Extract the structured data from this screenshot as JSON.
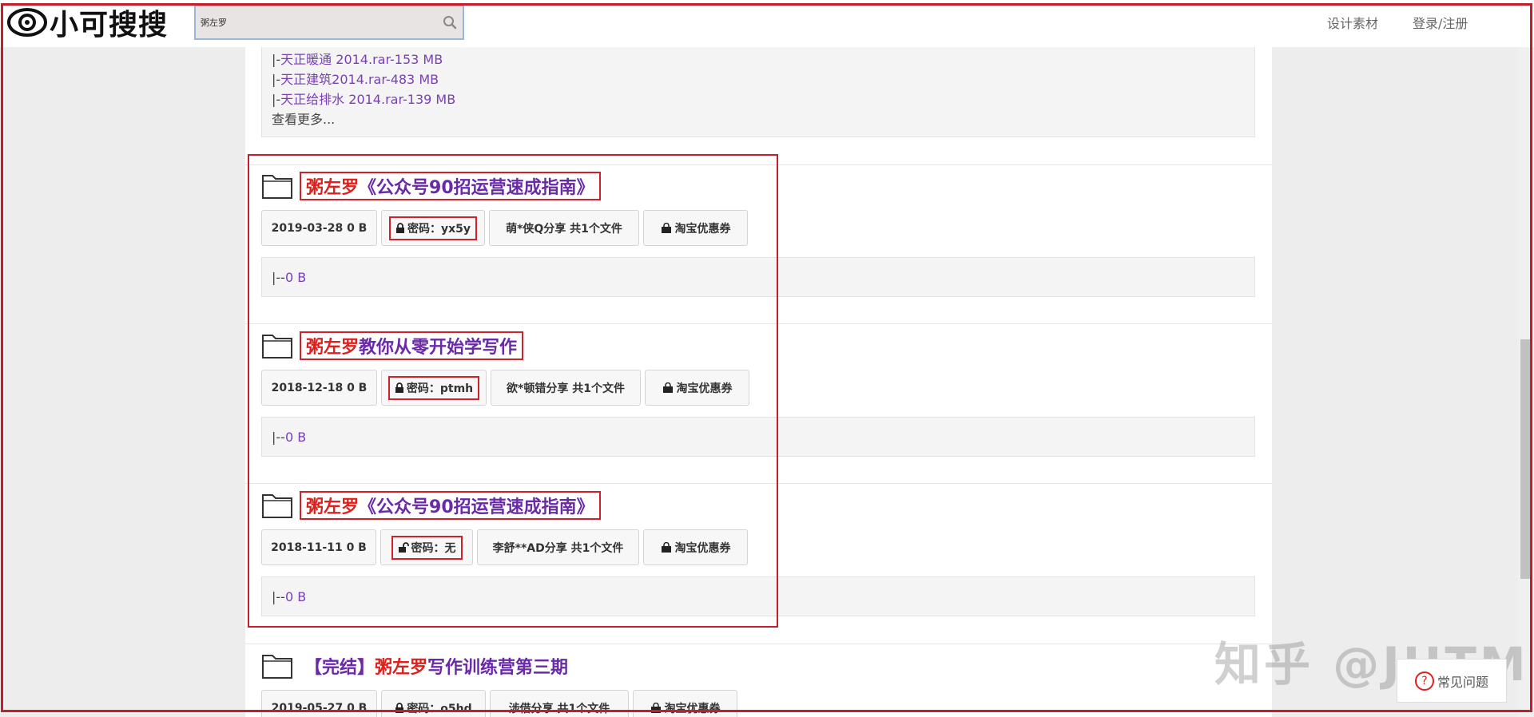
{
  "header": {
    "logo_text": "小可搜搜",
    "search_value": "粥左罗",
    "nav": {
      "design": "设计素材",
      "login": "登录/注册"
    }
  },
  "top_partial": {
    "files": [
      {
        "prefix": "|-",
        "name": "天正暖通 2014.rar-153 MB"
      },
      {
        "prefix": "|-",
        "name": "天正建筑2014.rar-483 MB"
      },
      {
        "prefix": "|-",
        "name": "天正给排水 2014.rar-139 MB"
      }
    ],
    "more": "查看更多..."
  },
  "results": [
    {
      "title_hl": "粥左罗",
      "title_rest": "《公众号90招运营速成指南》",
      "date_size": "2019-03-28 0 B",
      "password": "密码：yx5y",
      "lock": "locked",
      "sharer": "萌*侠Q分享 共1个文件",
      "coupon": "淘宝优惠券",
      "file_prefix": "|--",
      "file": "0 B"
    },
    {
      "title_hl": "粥左罗",
      "title_rest": "教你从零开始学写作",
      "date_size": "2018-12-18 0 B",
      "password": "密码：ptmh",
      "lock": "locked",
      "sharer": "欲*顿错分享 共1个文件",
      "coupon": "淘宝优惠券",
      "file_prefix": "|--",
      "file": "0 B"
    },
    {
      "title_hl": "粥左罗",
      "title_rest": "《公众号90招运营速成指南》",
      "date_size": "2018-11-11 0 B",
      "password": "密码：无",
      "lock": "unlocked",
      "sharer": "李舒**AD分享 共1个文件",
      "coupon": "淘宝优惠券",
      "file_prefix": "|--",
      "file": "0 B"
    },
    {
      "title_pre": "【完结】",
      "title_hl": "粥左罗",
      "title_rest": "写作训练营第三期",
      "date_size": "2019-05-27 0 B",
      "password": "密码：o5hd",
      "lock": "locked",
      "sharer": "涉借分享 共1个文件",
      "coupon": "淘宝优惠券"
    }
  ],
  "watermark": "知乎 @JHTM",
  "faq": "常见问题",
  "colors": {
    "highlight": "#e0201d",
    "title": "#6a2aa8",
    "annotation": "#c41e2a"
  }
}
